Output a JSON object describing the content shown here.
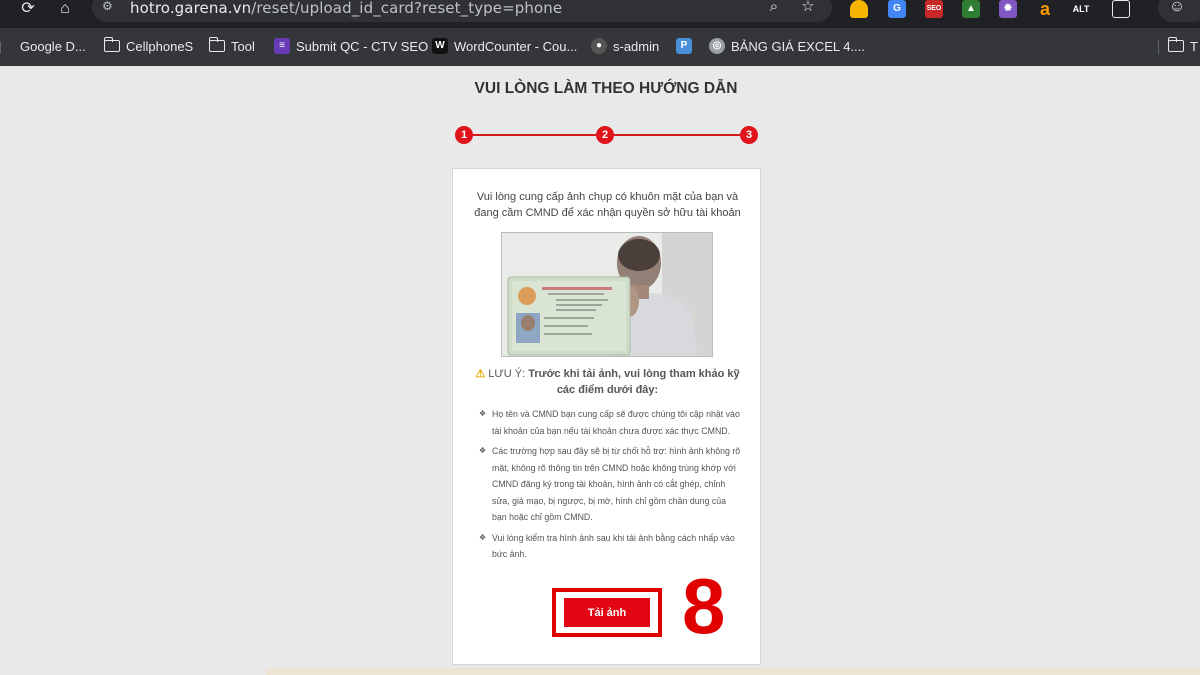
{
  "browser": {
    "url_host": "hotro.garena.vn",
    "url_path": "/reset/upload_id_card?reset_type=phone",
    "bookmarks": [
      {
        "label": "Google D...",
        "icon": "apps-icon"
      },
      {
        "label": "CellphoneS",
        "icon": "folder-icon"
      },
      {
        "label": "Tool",
        "icon": "folder-icon"
      },
      {
        "label": "Submit QC - CTV SEO",
        "icon": "forms-icon"
      },
      {
        "label": "WordCounter - Cou...",
        "icon": "wordcounter-icon"
      },
      {
        "label": "s-admin",
        "icon": "github-icon"
      },
      {
        "label": "",
        "icon": "p-icon"
      },
      {
        "label": "BẢNG GIÁ EXCEL 4....",
        "icon": "globe-icon"
      }
    ],
    "bookmark_overflow": "T",
    "bookmark_sep": "|"
  },
  "page": {
    "title": "VUI LÒNG LÀM THEO HƯỚNG DẪN",
    "steps": [
      "1",
      "2",
      "3"
    ],
    "intro": "Vui lòng cung cấp ảnh chụp có khuôn mặt của bạn và đang cầm CMND để xác nhận quyền sở hữu tài khoản",
    "note_prefix": "LƯU Ý:",
    "note_text": "Trước khi tải ảnh, vui lòng tham khảo kỹ các điểm dưới đây:",
    "rules": [
      "Họ tên và CMND bạn cung cấp sẽ được chúng tôi cập nhật vào tài khoản của bạn nếu tài khoản chưa được xác thực CMND.",
      "Các trường hợp sau đây sẽ bị từ chối hỗ trợ: hình ảnh không rõ mặt, không rõ thông tin trên CMND hoặc không trùng khớp với CMND đăng ký trong tài khoản, hình ảnh có cắt ghép, chỉnh sửa, giả mạo, bị ngược, bị mờ, hình chỉ gồm chân dung của bạn hoặc chỉ gồm CMND.",
      "Vui lòng kiểm tra hình ảnh sau khi tải ảnh bằng cách nhấp vào bức ảnh."
    ],
    "upload_label": "Tải ảnh",
    "annotation_number": "8"
  },
  "colors": {
    "accent_red": "#e30613",
    "annotation_red": "#e00000",
    "page_bg": "#e9e9e9",
    "chrome_dark": "#202124"
  }
}
